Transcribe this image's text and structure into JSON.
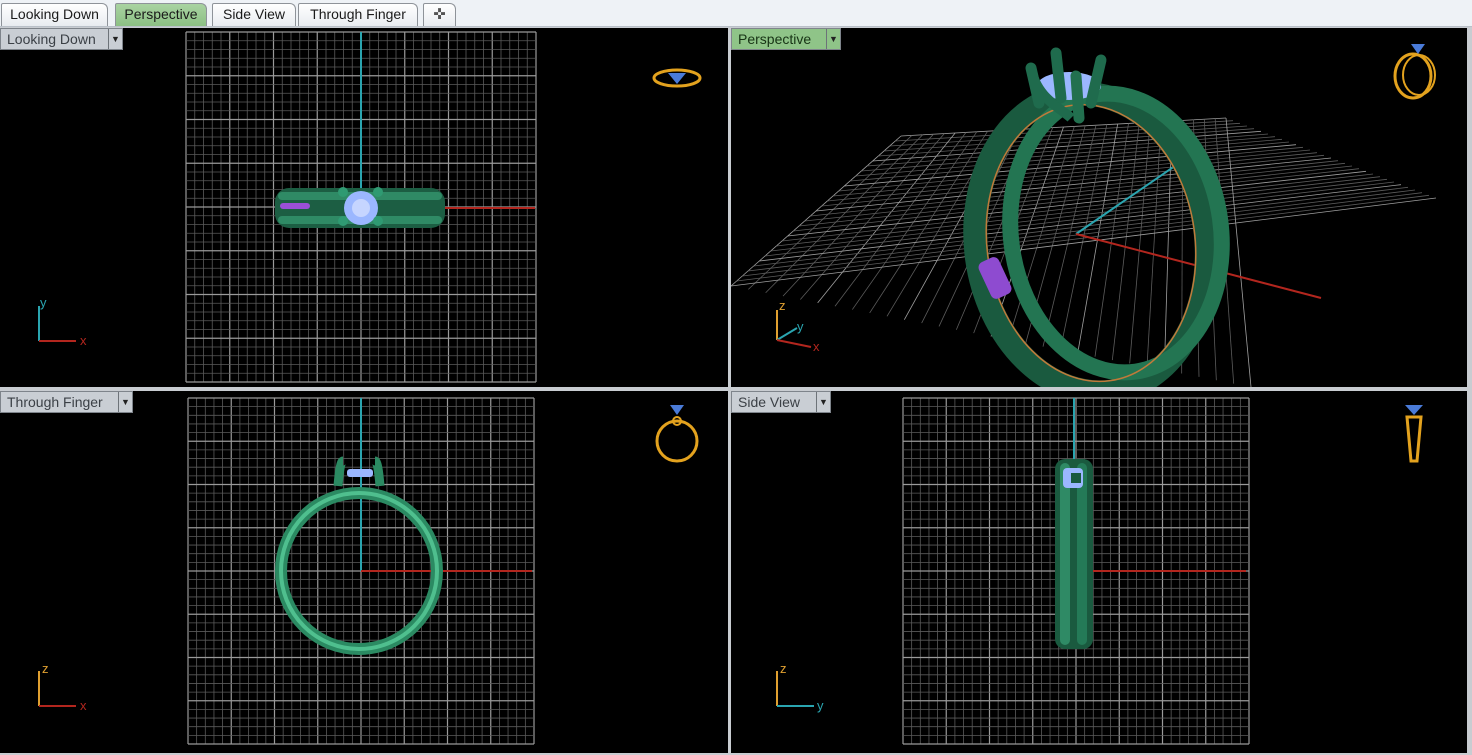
{
  "tabs": [
    {
      "label": "Looking Down",
      "active": false
    },
    {
      "label": "Perspective",
      "active": true
    },
    {
      "label": "Side View",
      "active": false
    },
    {
      "label": "Through Finger",
      "active": false
    }
  ],
  "tab_add_icon": "plus-icon",
  "viewports": {
    "top_left": {
      "label": "Looking Down",
      "axes": [
        "y",
        "x"
      ]
    },
    "top_right": {
      "label": "Perspective",
      "axes": [
        "z",
        "y",
        "x"
      ]
    },
    "bottom_left": {
      "label": "Through Finger",
      "axes": [
        "z",
        "x"
      ]
    },
    "bottom_right": {
      "label": "Side View",
      "axes": [
        "z",
        "y"
      ]
    }
  },
  "colors": {
    "active_tab": "#8cc084",
    "ring_metal": "#1f6b4d",
    "gem": "#9bb7ff",
    "axis_x": "#b3261e",
    "axis_y": "#2aa5b0",
    "axis_z": "#e0a030",
    "grid": "#8a8a8a",
    "nav_widget": "#e3a21e"
  },
  "icons": {
    "dropdown": "chevron-down-icon",
    "view_widget": "ring-preview-icon"
  }
}
